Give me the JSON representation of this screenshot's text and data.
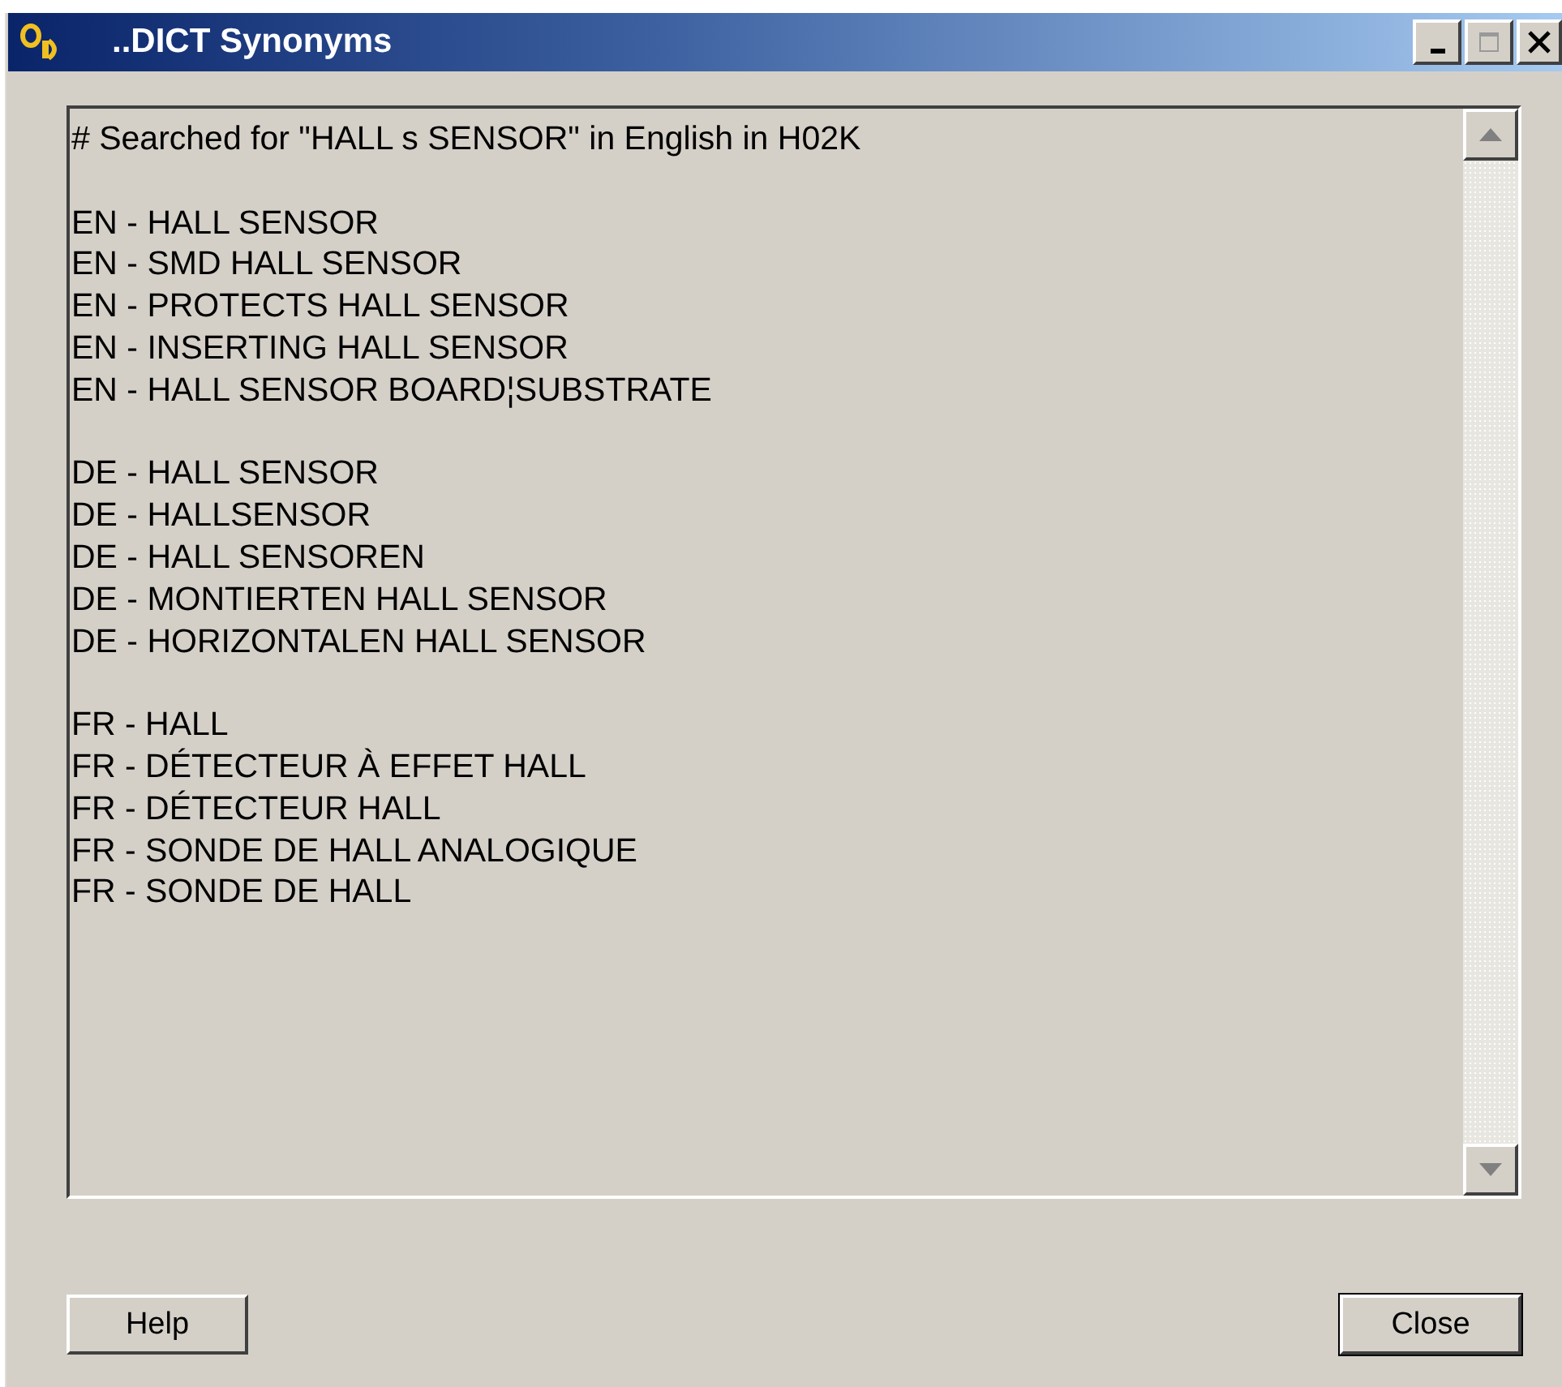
{
  "window": {
    "title": "..DICT Synonyms"
  },
  "results": {
    "header": "# Searched for \"HALL s SENSOR\" in English in H02K",
    "groups": [
      {
        "lines": [
          "EN - HALL SENSOR",
          "EN - SMD HALL SENSOR",
          "EN - PROTECTS HALL SENSOR",
          "EN - INSERTING HALL SENSOR",
          "EN - HALL SENSOR BOARD¦SUBSTRATE"
        ]
      },
      {
        "lines": [
          "DE - HALL SENSOR",
          "DE - HALLSENSOR",
          "DE - HALL SENSOREN",
          "DE - MONTIERTEN HALL SENSOR",
          "DE - HORIZONTALEN HALL SENSOR"
        ]
      },
      {
        "lines": [
          "FR - HALL",
          "FR - DÉTECTEUR À EFFET HALL",
          "FR - DÉTECTEUR HALL",
          "FR - SONDE DE HALL ANALOGIQUE",
          "FR - SONDE DE HALL"
        ]
      }
    ]
  },
  "buttons": [
    {
      "label": "Help",
      "default": false
    },
    {
      "label": "Close",
      "default": true
    }
  ]
}
